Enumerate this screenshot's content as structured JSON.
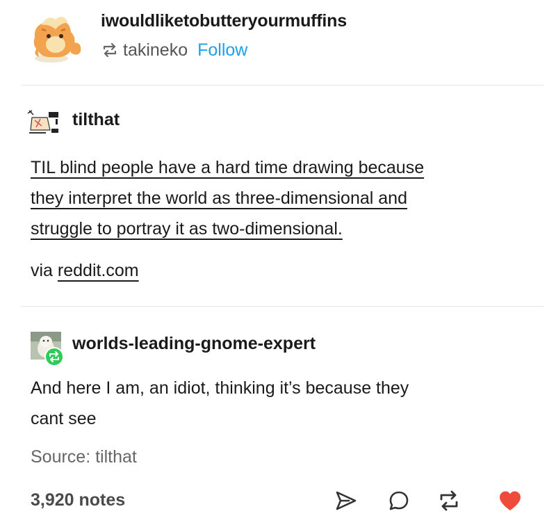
{
  "header": {
    "blog_name": "iwouldliketobutteryourmuffins",
    "reblogged_from": "takineko",
    "follow_label": "Follow"
  },
  "post1": {
    "author": "tilthat",
    "body_line1": "TIL blind people have a hard time drawing because",
    "body_line2": "they interpret the world as three-dimensional and",
    "body_line3": "struggle to portray it as two-dimensional.",
    "via_prefix": "via ",
    "via_link": "reddit.com"
  },
  "post2": {
    "author": "worlds-leading-gnome-expert",
    "body_line1": "And here I am, an idiot, thinking it’s because they",
    "body_line2": "cant see",
    "source": "Source: tilthat"
  },
  "footer": {
    "notes": "3,920 notes"
  },
  "icons": {
    "share": "share-icon",
    "reply": "reply-icon",
    "reblog": "reblog-icon",
    "like": "heart-icon"
  },
  "colors": {
    "follow": "#1da1e6",
    "heart": "#ef4a3a",
    "reblog_badge": "#2ecc57"
  }
}
